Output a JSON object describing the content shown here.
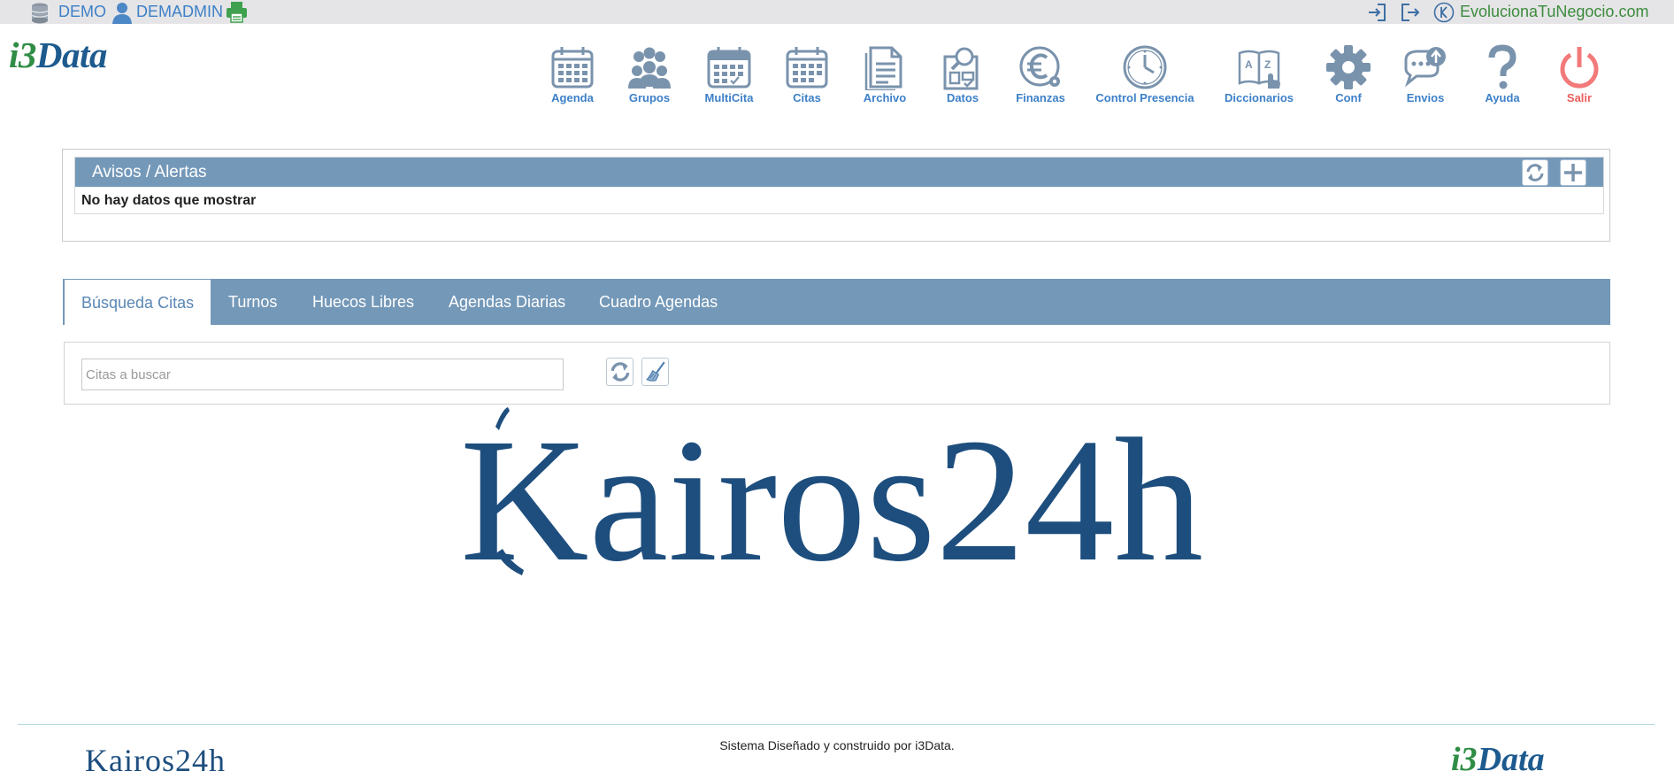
{
  "topbar": {
    "database": "DEMO",
    "user": "DEMADMIN",
    "site_link": "EvolucionaTuNegocio.com"
  },
  "logo": {
    "prefix": "i3",
    "suffix": "Data"
  },
  "nav": [
    {
      "label": "Agenda",
      "icon": "calendar-icon"
    },
    {
      "label": "Grupos",
      "icon": "group-icon"
    },
    {
      "label": "MultiCita",
      "icon": "multi-calendar-icon"
    },
    {
      "label": "Citas",
      "icon": "appointments-icon"
    },
    {
      "label": "Archivo",
      "icon": "document-icon"
    },
    {
      "label": "Datos",
      "icon": "data-search-icon"
    },
    {
      "label": "Finanzas",
      "icon": "euro-icon"
    },
    {
      "label": "Control Presencia",
      "icon": "clock-icon"
    },
    {
      "label": "Diccionarios",
      "icon": "dictionary-icon"
    },
    {
      "label": "Conf",
      "icon": "gear-icon"
    },
    {
      "label": "Envios",
      "icon": "chat-send-icon"
    },
    {
      "label": "Ayuda",
      "icon": "question-icon"
    },
    {
      "label": "Salir",
      "icon": "power-icon"
    }
  ],
  "alerts": {
    "title": "Avisos / Alertas",
    "empty_message": "No hay datos que mostrar"
  },
  "tabs": [
    {
      "label": "Búsqueda Citas",
      "active": true
    },
    {
      "label": "Turnos",
      "active": false
    },
    {
      "label": "Huecos Libres",
      "active": false
    },
    {
      "label": "Agendas Diarias",
      "active": false
    },
    {
      "label": "Cuadro Agendas",
      "active": false
    }
  ],
  "search": {
    "placeholder": "Citas a buscar",
    "value": ""
  },
  "brand": {
    "name": "Kairos24h"
  },
  "footer": {
    "credit": "Sistema Diseñado y construido por i3Data.",
    "left_logo": "Kairos24h",
    "right_logo_prefix": "i3",
    "right_logo_suffix": "Data"
  },
  "colors": {
    "accent": "#3d80c8",
    "header_bar": "#7498b8",
    "brand_navy": "#1d4e7e",
    "logo_green": "#2f8d46",
    "exit_red": "#ee5c5c"
  }
}
